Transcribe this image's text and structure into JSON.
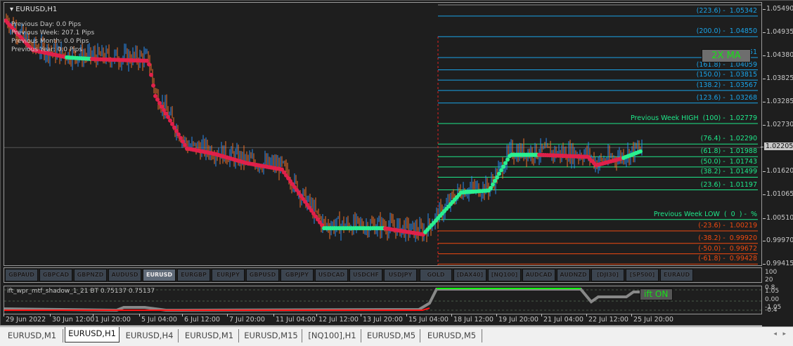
{
  "chart": {
    "title": "EURUSD,H1",
    "info": [
      "Previous Day: 0.0 Pips",
      "Previous Week: 207.1 Pips",
      "Previous Month: 0.0 Pips",
      "Previous Year: 0.0 Pips"
    ],
    "badge": "2X MA",
    "current_price": "1.02205",
    "price_ticks": [
      "1.05490",
      "1.04935",
      "1.04380",
      "1.03825",
      "1.03285",
      "1.02730",
      "1.01620",
      "1.01065",
      "1.00510",
      "0.99970",
      "0.99415"
    ],
    "price_tick_values": [
      1.0549,
      1.04935,
      1.0438,
      1.03825,
      1.03285,
      1.0273,
      1.0162,
      1.01065,
      1.0051,
      0.9997,
      0.99415
    ],
    "fib_levels": [
      {
        "label": "(223.6) -  1.05342",
        "price": 1.05342,
        "color": "#1aa3e8"
      },
      {
        "label": "(200.0) -  1.04850",
        "price": 1.0485,
        "color": "#1aa3e8"
      },
      {
        "label": "51",
        "price": 1.04351,
        "color": "#1aa3e8"
      },
      {
        "label": "(161.8) -  1.04059",
        "price": 1.04059,
        "color": "#1aa3e8"
      },
      {
        "label": "(150.0) -  1.03815",
        "price": 1.03815,
        "color": "#1aa3e8"
      },
      {
        "label": "(138.2) -  1.03567",
        "price": 1.03567,
        "color": "#1aa3e8"
      },
      {
        "label": "(123.6) -  1.03268",
        "price": 1.03268,
        "color": "#1aa3e8"
      },
      {
        "label": "Previous Week HIGH  (100) -  1.02779",
        "price": 1.02779,
        "color": "#1ee88a"
      },
      {
        "label": "(76.4) -  1.02290",
        "price": 1.0229,
        "color": "#1ee88a"
      },
      {
        "label": "(61.8) -  1.01988",
        "price": 1.01988,
        "color": "#1ee88a"
      },
      {
        "label": "(50.0) -  1.01743",
        "price": 1.01743,
        "color": "#1ee88a"
      },
      {
        "label": "(38.2) -  1.01499",
        "price": 1.01499,
        "color": "#1ee88a"
      },
      {
        "label": "(23.6) -  1.01197",
        "price": 1.01197,
        "color": "#1ee88a"
      },
      {
        "label": "Previous Week LOW  (  0  ) -  %",
        "price": 1.0049,
        "color": "#1ee88a"
      },
      {
        "label": "(-23.6) -  1.00219",
        "price": 1.00219,
        "color": "#f04a10"
      },
      {
        "label": "(-38.2) -  0.99920",
        "price": 0.9992,
        "color": "#f04a10"
      },
      {
        "label": "(-50.0) -  0.99672",
        "price": 0.99672,
        "color": "#f04a10"
      },
      {
        "label": "(-61.8) -  0.99428",
        "price": 0.99428,
        "color": "#f04a10"
      }
    ],
    "colors": {
      "ma_down": "#e0204a",
      "ma_up": "#2af090",
      "bull": "#2a8cf0",
      "bear": "#f07028"
    }
  },
  "symbols": [
    "GBPAUD",
    "GBPCAD",
    "GBPNZD",
    "AUDUSD",
    "EURUSD",
    "EURGBP",
    "EURJPY",
    "GBPUSD",
    "GBPJPY",
    "USDCAD",
    "USDCHF",
    "USDJPY",
    "GOLD",
    "[DAX40]",
    "[NQ100]",
    "AUDCAD",
    "AUDNZD",
    "[DJI30]",
    "[SP500]",
    "EURAUD"
  ],
  "active_symbol": "EURUSD",
  "symbol_axis": [
    "100",
    "20"
  ],
  "indicator": {
    "label": "ift_wpr_mtf_shadow_1_21  BT 0.75137 0.75137",
    "badge": "ift ON",
    "ticks": [
      "0.8",
      "1.05",
      "0.00",
      "-1.05",
      "-0.4"
    ]
  },
  "time_labels": [
    "29 Jun 2022",
    "30 Jun 12:00",
    "1 Jul 20:00",
    "5 Jul 04:00",
    "6 Jul 12:00",
    "7 Jul 20:00",
    "11 Jul 04:00",
    "12 Jul 12:00",
    "13 Jul 20:00",
    "15 Jul 04:00",
    "18 Jul 12:00",
    "19 Jul 20:00",
    "21 Jul 04:00",
    "22 Jul 12:00",
    "25 Jul 20:00"
  ],
  "tabs": [
    "EURUSD,M1",
    "EURUSD,H1",
    "EURUSD,H4",
    "EURUSD,M1",
    "EURUSD,M15",
    "[NQ100],H1",
    "EURUSD,M5",
    "EURUSD,M5"
  ],
  "active_tab": "EURUSD,H1"
}
